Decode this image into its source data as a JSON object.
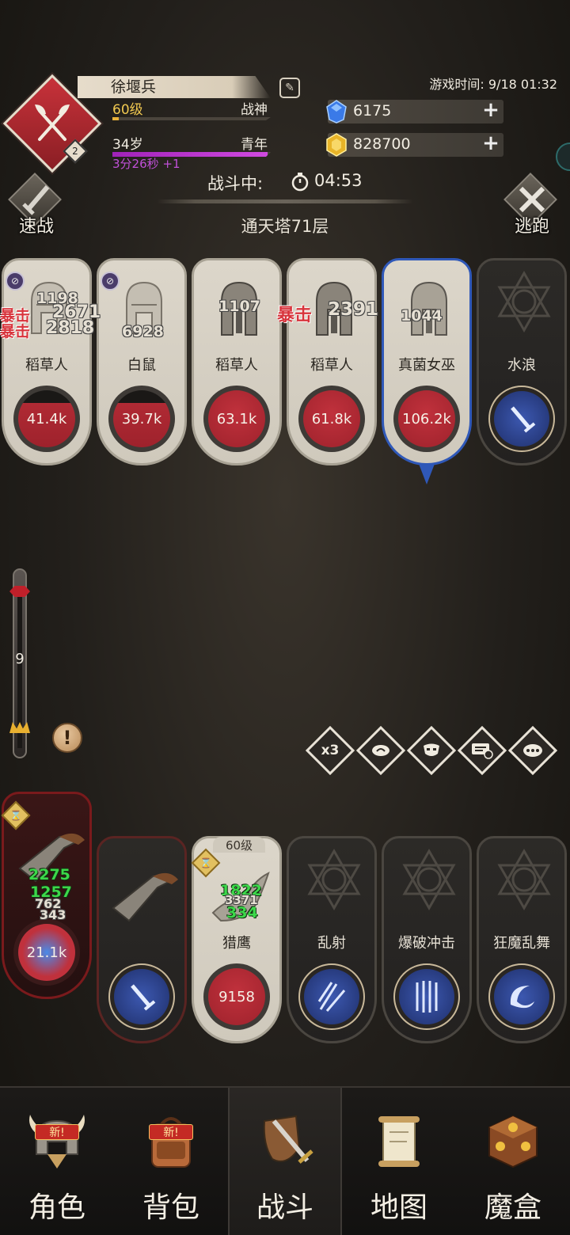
{
  "player": {
    "name": "徐堰兵",
    "level": "60级",
    "title": "战神",
    "age": "34岁",
    "life_stage": "青年",
    "age_timer": "3分26秒 +1",
    "emblem_badge": "2",
    "level_progress": 0.04,
    "age_progress": 0.98
  },
  "game_time": "游戏时间: 9/18 01:32",
  "currency": {
    "gems": "6175",
    "gold": "828700"
  },
  "battle": {
    "status": "战斗中:",
    "timer": "04:53",
    "floor": "通天塔71层",
    "quick_battle": "速战",
    "flee": "逃跑"
  },
  "enemies": [
    {
      "name": "稻草人",
      "hp": "41.4k",
      "portrait": "helmet-icon"
    },
    {
      "name": "白鼠",
      "hp": "39.7k",
      "portrait": "helmet-icon"
    },
    {
      "name": "稻草人",
      "hp": "63.1k",
      "portrait": "spartan-helmet-icon"
    },
    {
      "name": "稻草人",
      "hp": "61.8k",
      "portrait": "spartan-helmet-icon"
    },
    {
      "name": "真菌女巫",
      "hp": "106.2k",
      "portrait": "spartan-helmet-icon"
    },
    {
      "name": "水浪",
      "skill": "sword-icon"
    }
  ],
  "damage_numbers": {
    "e1_top": "1198",
    "e1_crit_label": "暴击",
    "e1_crit": "2671",
    "e1_crit2_label": "暴击",
    "e1_val2": "2818",
    "e2": "6928",
    "e3": "1107",
    "e4_crit_label": "暴击",
    "e4_crit": "2391",
    "e5": "1044",
    "a1_heal_1": "2275",
    "a1_heal_2": "1257",
    "a1_heal_3": "762",
    "a1_heal_4": "343",
    "a3_heal_1": "1822",
    "a3_heal_2": "3371",
    "a3_heal_3": "334"
  },
  "allies": [
    {
      "name": "",
      "hp": "21.1k"
    },
    {
      "name": "",
      "skill": "sword-icon"
    },
    {
      "name": "猎鹰",
      "hp": "9158",
      "level": "60级"
    },
    {
      "name": "乱射",
      "skill": "arrow-burst-icon"
    },
    {
      "name": "爆破冲击",
      "skill": "blast-icon"
    },
    {
      "name": "狂魔乱舞",
      "skill": "whirl-icon"
    }
  ],
  "wave_progress": "9",
  "controls": [
    "x3",
    "mask",
    "auto",
    "chat-off",
    "chat"
  ],
  "nav": [
    {
      "label": "角色",
      "badge": "新!"
    },
    {
      "label": "背包",
      "badge": "新!"
    },
    {
      "label": "战斗",
      "badge": ""
    },
    {
      "label": "地图",
      "badge": ""
    },
    {
      "label": "魔盒",
      "badge": ""
    }
  ],
  "colors": {
    "hp_red": "#b02a34",
    "skill_blue": "#2f4ea0",
    "selected_border": "#2f58b8",
    "crit_red": "#d8343c",
    "heal_green": "#3cd84a"
  }
}
